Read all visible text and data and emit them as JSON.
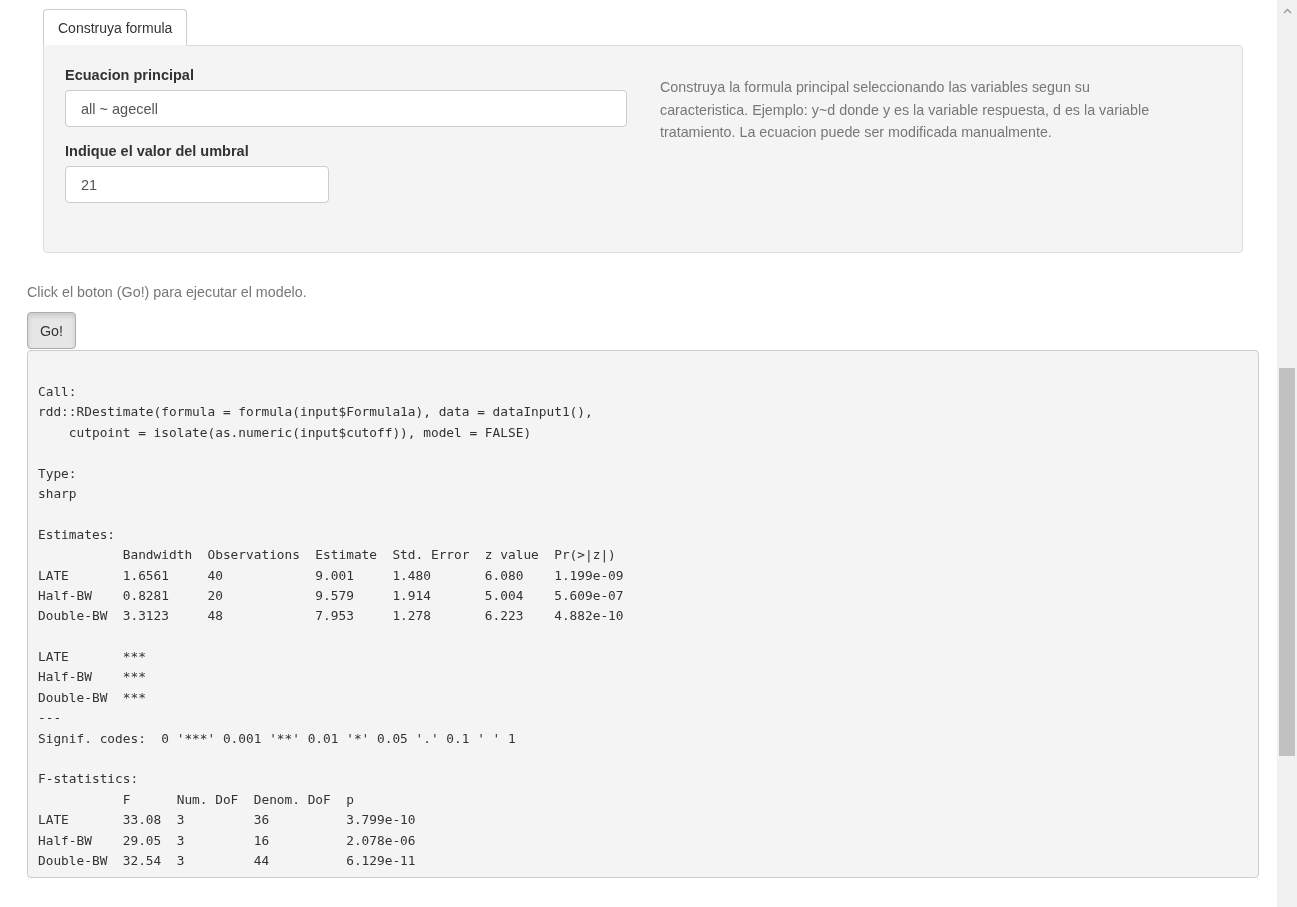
{
  "tabs": [
    {
      "label": "Construya formula",
      "selected": true
    }
  ],
  "panel": {
    "fields": [
      {
        "label": "Ecuacion principal",
        "value": "all ~ agecell",
        "wide": true
      },
      {
        "label": "Indique el valor del umbral",
        "value": "21",
        "wide": false
      }
    ],
    "help_text": "Construya la formula principal seleccionando las variables segun su caracteristica. Ejemplo: y~d donde y es la variable respuesta, d es la variable tratamiento. La ecuacion puede ser modificada manualmente."
  },
  "instruction": "Click el boton (Go!) para ejecutar el modelo.",
  "go_button": "Go!",
  "output": [
    [
      "Call:",
      "rdd::RDestimate(formula = formula(input$Formula1a), data = dataInput1(),",
      "    cutpoint = isolate(as.numeric(input$cutoff)), model = FALSE)"
    ],
    [
      "Type:",
      "sharp"
    ],
    [
      "Estimates:",
      "           Bandwidth  Observations  Estimate  Std. Error  z value  Pr(>|z|)",
      "LATE       1.6561     40            9.001     1.480       6.080    1.199e-09",
      "Half-BW    0.8281     20            9.579     1.914       5.004    5.609e-07",
      "Double-BW  3.3123     48            7.953     1.278       6.223    4.882e-10"
    ],
    [
      "LATE       ***",
      "Half-BW    ***",
      "Double-BW  ***",
      "---",
      "Signif. codes:  0 '***' 0.001 '**' 0.01 '*' 0.05 '.' 0.1 ' ' 1"
    ],
    [
      "F-statistics:",
      "           F      Num. DoF  Denom. DoF  p",
      "LATE       33.08  3         36          3.799e-10",
      "Half-BW    29.05  3         16          2.078e-06",
      "Double-BW  32.54  3         44          6.129e-11"
    ]
  ]
}
